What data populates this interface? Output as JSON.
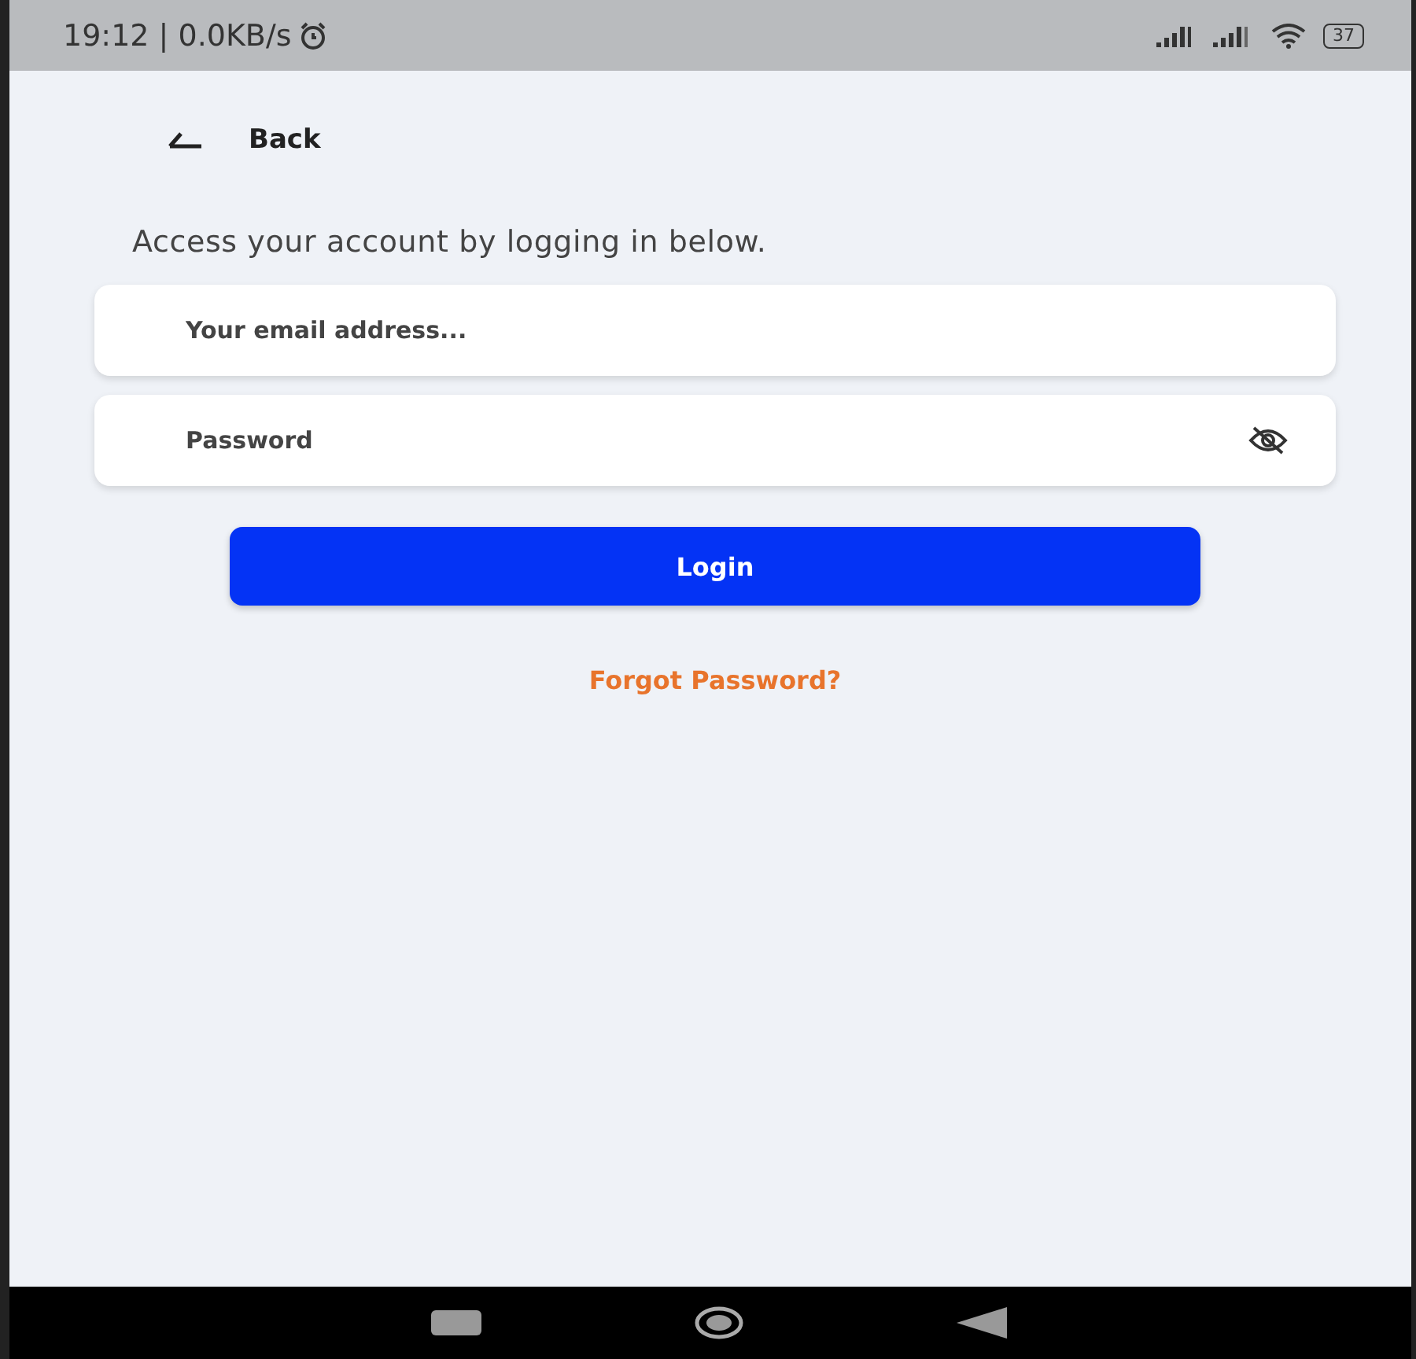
{
  "status_bar": {
    "time": "19:12 | 0.0KB/s",
    "battery": "37"
  },
  "back": {
    "label": "Back"
  },
  "subtitle": "Access your account by logging in below.",
  "email": {
    "placeholder": "Your email address..."
  },
  "password": {
    "placeholder": "Password",
    "visible": false
  },
  "login_button": "Login",
  "forgot_link": "Forgot Password?"
}
